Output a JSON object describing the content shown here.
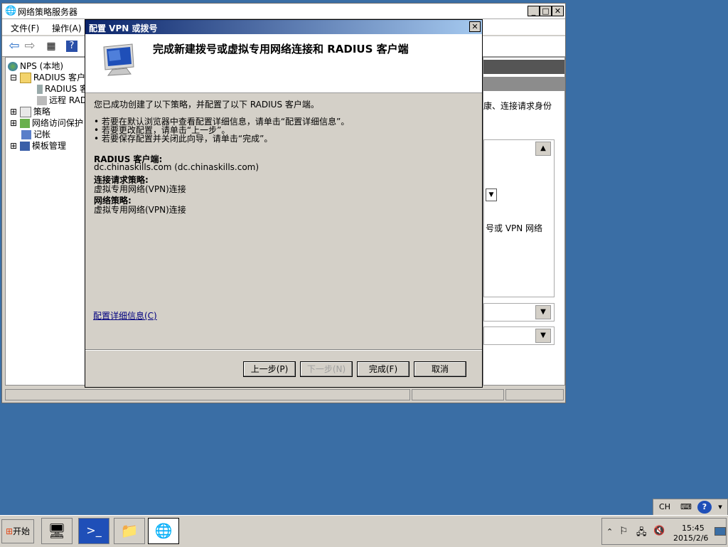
{
  "main_window": {
    "title": "网络策略服务器",
    "menus": [
      "文件(F)",
      "操作(A)"
    ],
    "tree": [
      {
        "expander": "",
        "label": "NPS (本地)",
        "indent": 0
      },
      {
        "expander": "⊟",
        "label": "RADIUS 客户端",
        "indent": 1
      },
      {
        "expander": "",
        "label": "RADIUS 客",
        "indent": 2
      },
      {
        "expander": "",
        "label": "远程 RAD",
        "indent": 2
      },
      {
        "expander": "⊞",
        "label": "策略",
        "indent": 1
      },
      {
        "expander": "⊞",
        "label": "网络访问保护",
        "indent": 1
      },
      {
        "expander": "",
        "label": "记帐",
        "indent": 1
      },
      {
        "expander": "⊞",
        "label": "模板管理",
        "indent": 1
      }
    ],
    "right_pane": {
      "text1": "康、连接请求身份",
      "text2": "号或 VPN 网络"
    }
  },
  "wizard": {
    "title": "配置 VPN 或拨号",
    "heading": "完成新建拨号或虚拟专用网络连接和 RADIUS 客户端",
    "intro": "您已成功创建了以下策略，并配置了以下 RADIUS 客户端。",
    "bullets": [
      "• 若要在默认浏览器中查看配置详细信息，请单击“配置详细信息”。",
      "• 若要更改配置，请单击“上一步”。",
      "• 若要保存配置并关闭此向导，请单击“完成”。"
    ],
    "sections": [
      {
        "heading": "RADIUS 客户端:",
        "value": "dc.chinaskills.com (dc.chinaskills.com)"
      },
      {
        "heading": "连接请求策略:",
        "value": "虚拟专用网络(VPN)连接"
      },
      {
        "heading": "网络策略:",
        "value": "虚拟专用网络(VPN)连接"
      }
    ],
    "details_link": "配置详细信息(C)",
    "buttons": {
      "back": "上一步(P)",
      "next": "下一步(N)",
      "finish": "完成(F)",
      "cancel": "取消"
    }
  },
  "taskbar": {
    "start_label": "开始",
    "language": "CH",
    "time": "15:45",
    "date": "2015/2/6"
  }
}
